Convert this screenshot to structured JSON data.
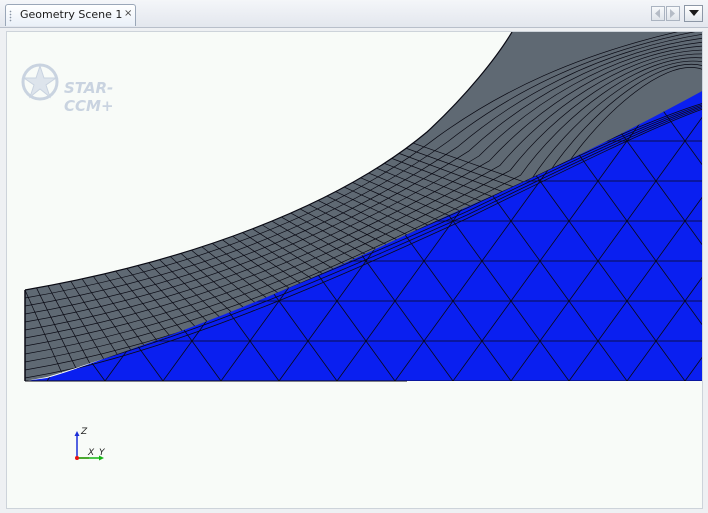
{
  "tab": {
    "title": "Geometry Scene 1",
    "close_glyph": "×"
  },
  "icons": {
    "tab_grip": "grip-dots-icon",
    "scroll_left": "arrow-left-icon",
    "scroll_right": "arrow-right-icon",
    "tab_menu": "chevron-down-icon",
    "logo": "star-ccm-logo-icon"
  },
  "viewport": {
    "logo_text": "STAR-CCM+",
    "axes": {
      "z": "Z",
      "x": "X",
      "y": "Y"
    },
    "colors": {
      "background": "#f8fbf8",
      "blue_surface": "#0a1ff0",
      "gray_surface": "#5f6973",
      "mesh_line": "#0a0a14",
      "z_axis": "#1c2fd8",
      "x_axis": "#e81212",
      "y_axis": "#14b414"
    }
  }
}
